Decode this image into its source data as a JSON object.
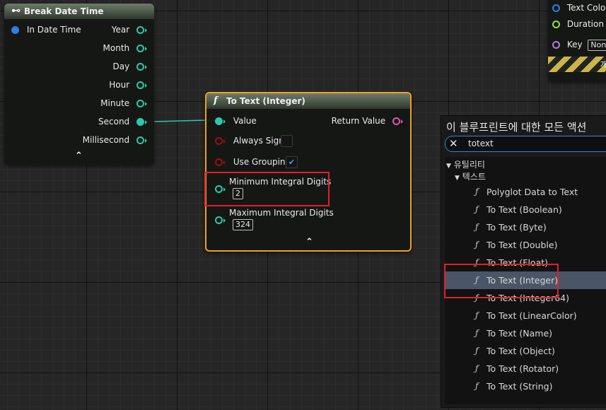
{
  "break_node": {
    "title": "Break Date Time",
    "input_label": "In Date Time",
    "outputs": [
      "Year",
      "Month",
      "Day",
      "Hour",
      "Minute",
      "Second",
      "Millisecond"
    ]
  },
  "totext_node": {
    "title": "To Text (Integer)",
    "value_label": "Value",
    "return_label": "Return Value",
    "always_sign_label": "Always Sign",
    "always_sign_checked": false,
    "use_grouping_label": "Use Grouping",
    "use_grouping_checked": true,
    "min_digits_label": "Minimum Integral Digits",
    "min_digits_value": "2",
    "max_digits_label": "Maximum Integral Digits",
    "max_digits_value": "324"
  },
  "right_node": {
    "text_color_label": "Text Color",
    "duration_label": "Duration",
    "key_label": "Key",
    "key_value": "None",
    "dev_label": "개발"
  },
  "action_menu": {
    "title": "이 블루프린트에 대한 모든 액션",
    "search_value": "totext",
    "category": "유틸리티",
    "subcategory": "텍스트",
    "items": [
      "Polyglot Data to Text",
      "To Text (Boolean)",
      "To Text (Byte)",
      "To Text (Double)",
      "To Text (Float)",
      "To Text (Integer)",
      "To Text (Integer64)",
      "To Text (LinearColor)",
      "To Text (Name)",
      "To Text (Object)",
      "To Text (Rotator)",
      "To Text (String)"
    ],
    "selected_index": 5
  },
  "colors": {
    "highlight_red": "#e0202a",
    "selected_node_border": "#f0a020",
    "int_pin": "#2ec8a8",
    "bool_pin": "#9a1010",
    "text_pin": "#d45ab0",
    "struct_pin": "#2f7de6",
    "selected_item_bg": "#4a5568"
  }
}
